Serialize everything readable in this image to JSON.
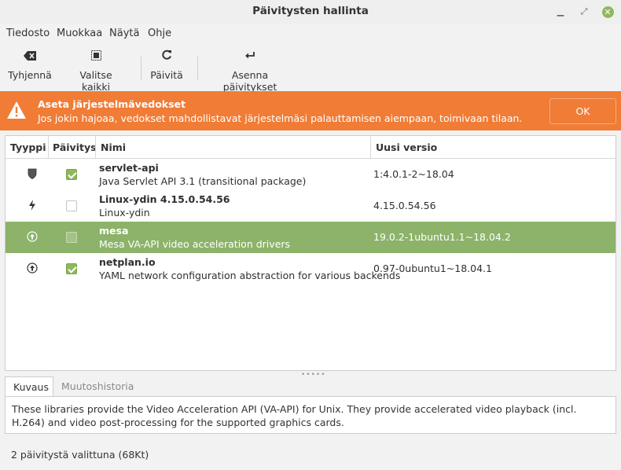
{
  "window": {
    "title": "Päivitysten hallinta"
  },
  "menu": [
    "Tiedosto",
    "Muokkaa",
    "Näytä",
    "Ohje"
  ],
  "toolbar": {
    "clear": "Tyhjennä",
    "select_all": "Valitse kaikki",
    "refresh": "Päivitä",
    "install": "Asenna päivitykset"
  },
  "infobar": {
    "heading": "Aseta järjestelmävedokset",
    "text": "Jos jokin hajoaa, vedokset mahdollistavat järjestelmäsi palauttamisen aiempaan, toimivaan tilaan.",
    "ok": "OK",
    "color": "#f07c36"
  },
  "columns": {
    "type": "Tyyppi",
    "update": "Päivitys",
    "name": "Nimi",
    "version": "Uusi versio"
  },
  "updates": [
    {
      "type_icon": "shield-icon",
      "checked": true,
      "name": "servlet-api",
      "description": "Java Servlet API 3.1 (transitional package)",
      "version": "1:4.0.1-2~18.04",
      "selected": false
    },
    {
      "type_icon": "lightning-icon",
      "checked": false,
      "name": "Linux-ydin 4.15.0.54.56",
      "description": "Linux-ydin",
      "version": "4.15.0.54.56",
      "selected": false
    },
    {
      "type_icon": "upgrade-arrow-icon",
      "checked": false,
      "name": "mesa",
      "description": "Mesa VA-API video acceleration drivers",
      "version": "19.0.2-1ubuntu1.1~18.04.2",
      "selected": true
    },
    {
      "type_icon": "upgrade-arrow-icon",
      "checked": true,
      "name": "netplan.io",
      "description": "YAML network configuration abstraction for various backends",
      "version": "0.97-0ubuntu1~18.04.1",
      "selected": false
    }
  ],
  "tabs": {
    "description": "Kuvaus",
    "changelog": "Muutoshistoria"
  },
  "description_text": "These libraries provide the Video Acceleration API (VA-API) for Unix. They provide accelerated video playback (incl. H.264) and video post-processing for the supported graphics cards.",
  "status": "2 päivitystä valittuna (68Kt)",
  "colors": {
    "selection": "#8cb369",
    "accent": "#8fb85e"
  }
}
